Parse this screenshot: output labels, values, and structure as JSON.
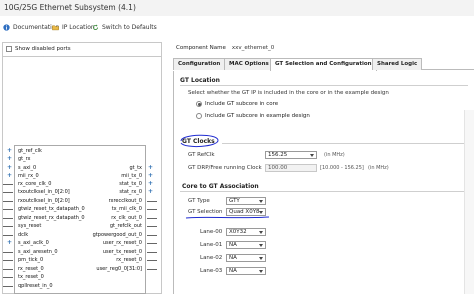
{
  "window": {
    "title": "10G/25G Ethernet Subsystem (4.1)"
  },
  "toolbar": {
    "documentation": "Documentation",
    "ip_location": "IP Location",
    "switch_defaults": "Switch to Defaults",
    "icons": [
      "info-icon",
      "folder-icon",
      "refresh-icon"
    ]
  },
  "left": {
    "show_disabled": "Show disabled ports",
    "ports_left": [
      "gt_ref_clk",
      "gt_rx",
      "s_axi_0",
      "mii_rx_0",
      "rx_core_clk_0",
      "txoutclksel_in_0[2:0]",
      "rxoutclksel_in_0[2:0]",
      "gtwiz_reset_tx_datapath_0",
      "gtwiz_reset_rx_datapath_0",
      "sys_reset",
      "dclk",
      "s_axi_aclk_0",
      "s_axi_aresetn_0",
      "pm_tick_0",
      "rx_reset_0",
      "tx_reset_0",
      "qpllreset_in_0"
    ],
    "ports_right": [
      "gt_tx",
      "mii_tx_0",
      "stat_tx_0",
      "stat_rx_0",
      "rxrecclkout_0",
      "tx_mii_clk_0",
      "rx_clk_out_0",
      "gt_refclk_out",
      "gtpowergood_out_0",
      "user_rx_reset_0",
      "user_tx_reset_0",
      "rx_reset_0",
      "user_reg0_0[31:0]"
    ]
  },
  "right": {
    "component_name_label": "Component Name",
    "component_name_value": "xxv_ethernet_0",
    "tabs": [
      "Configuration",
      "MAC Options",
      "GT Selection and Configuration",
      "Shared Logic"
    ],
    "active_tab": "GT Selection and Configuration",
    "gt_location": {
      "title": "GT Location",
      "description": "Select whether the GT IP is included in the core or in the example design",
      "option_core": "Include GT subcore in core",
      "option_example": "Include GT subcore in example design",
      "selected": "Include GT subcore in core"
    },
    "gt_clocks": {
      "title": "GT Clocks",
      "refclk_label": "GT RefClk",
      "refclk_value": "156.25",
      "refclk_unit": "(in MHz)",
      "drp_label": "GT DRP/Free running Clock",
      "drp_value": "100.00",
      "drp_range": "[10.000 - 156.25]",
      "drp_unit": "(in MHz)"
    },
    "core_to_gt": {
      "title": "Core to GT Association",
      "gt_type_label": "GT Type",
      "gt_type_value": "GTY",
      "gt_selection_label": "GT Selection",
      "gt_selection_value": "Quad X0Y8",
      "lanes": [
        {
          "label": "Lane-00",
          "value": "X0Y32"
        },
        {
          "label": "Lane-01",
          "value": "NA"
        },
        {
          "label": "Lane-02",
          "value": "NA"
        },
        {
          "label": "Lane-03",
          "value": "NA"
        }
      ]
    },
    "annotation_color": "#1f2bd1"
  }
}
